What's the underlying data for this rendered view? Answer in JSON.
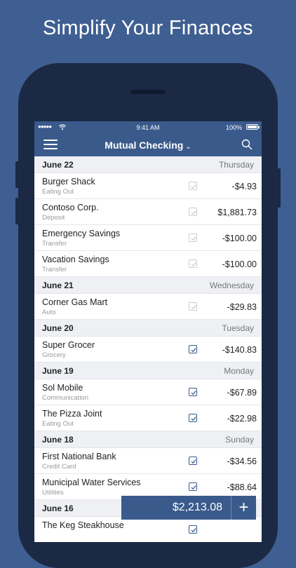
{
  "headline": "Simplify Your Finances",
  "status": {
    "signal": "●●●●●",
    "time": "9:41 AM",
    "battery": "100%"
  },
  "nav": {
    "title": "Mutual Checking",
    "chevron": "⌄"
  },
  "groups": [
    {
      "date": "June 22",
      "day": "Thursday",
      "items": [
        {
          "name": "Burger Shack",
          "category": "Eating Out",
          "amount": "-$4.93",
          "cleared": false
        },
        {
          "name": "Contoso Corp.",
          "category": "Deposit",
          "amount": "$1,881.73",
          "cleared": false
        },
        {
          "name": "Emergency Savings",
          "category": "Transfer",
          "amount": "-$100.00",
          "cleared": false
        },
        {
          "name": "Vacation Savings",
          "category": "Transfer",
          "amount": "-$100.00",
          "cleared": false
        }
      ]
    },
    {
      "date": "June 21",
      "day": "Wednesday",
      "items": [
        {
          "name": "Corner Gas Mart",
          "category": "Auto",
          "amount": "-$29.83",
          "cleared": false
        }
      ]
    },
    {
      "date": "June 20",
      "day": "Tuesday",
      "items": [
        {
          "name": "Super Grocer",
          "category": "Grocery",
          "amount": "-$140.83",
          "cleared": true
        }
      ]
    },
    {
      "date": "June 19",
      "day": "Monday",
      "items": [
        {
          "name": "Sol Mobile",
          "category": "Communication",
          "amount": "-$67.89",
          "cleared": true
        },
        {
          "name": "The Pizza Joint",
          "category": "Eating Out",
          "amount": "-$22.98",
          "cleared": true
        }
      ]
    },
    {
      "date": "June 18",
      "day": "Sunday",
      "items": [
        {
          "name": "First National Bank",
          "category": "Credit Card",
          "amount": "-$34.56",
          "cleared": true
        },
        {
          "name": "Municipal Water Services",
          "category": "Utilities",
          "amount": "-$88.64",
          "cleared": true
        }
      ]
    },
    {
      "date": "June 16",
      "day": "",
      "items": [
        {
          "name": "The Keg Steakhouse",
          "category": "",
          "amount": "",
          "cleared": true
        }
      ]
    }
  ],
  "balance": {
    "total": "$2,213.08",
    "add_label": "+"
  },
  "colors": {
    "bg": "#3f5f92",
    "nav": "#3a5a8c",
    "phone": "#1b2944"
  }
}
